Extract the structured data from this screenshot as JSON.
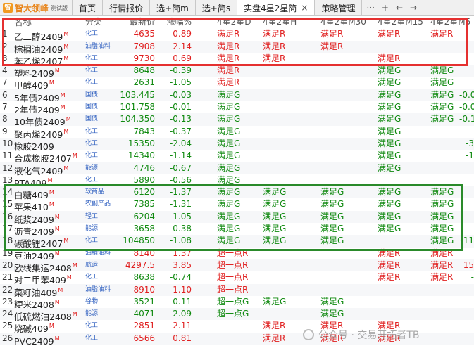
{
  "app": {
    "logo_badge": "智",
    "name": "智大领峰",
    "edition": "测试版"
  },
  "tabs": [
    {
      "label": "首页"
    },
    {
      "label": "行情报价"
    },
    {
      "label": "选+简m"
    },
    {
      "label": "选+简s"
    },
    {
      "label": "实盘4星2星简",
      "active": true
    },
    {
      "label": "策略管理"
    }
  ],
  "tab_close": "×",
  "tools": {
    "more": "···",
    "add": "+",
    "back": "←",
    "forward": "→"
  },
  "columns": [
    "名称",
    "分类",
    "最新价",
    "涨幅%",
    "4星2星D",
    "4星2星H",
    "4星2星M30",
    "4星2星M15",
    "4星2星M5",
    ""
  ],
  "rows": [
    {
      "idx": "1",
      "name": "乙二醇2409",
      "sup": "M",
      "cat": "化工",
      "price": "4635",
      "chg": "0.89",
      "d": [
        "满足R",
        "满足R",
        "满足R",
        "满足R",
        "满足R"
      ],
      "x": ""
    },
    {
      "idx": "2",
      "name": "棕榈油2409",
      "sup": "M",
      "cat": "油脂油料",
      "price": "7908",
      "chg": "2.14",
      "d": [
        "满足R",
        "满足R",
        "满足R",
        "",
        ""
      ],
      "x": ""
    },
    {
      "idx": "3",
      "name": "苯乙烯2407",
      "sup": "M",
      "cat": "化工",
      "price": "9730",
      "chg": "0.69",
      "d": [
        "满足R",
        "满足R",
        "",
        "满足R",
        ""
      ],
      "x": ""
    },
    {
      "idx": "4",
      "name": "塑料2409",
      "sup": "M",
      "cat": "化工",
      "price": "8648",
      "chg": "-0.39",
      "d": [
        "满足R",
        "",
        "",
        "满足G",
        "满足G"
      ],
      "x": ""
    },
    {
      "idx": "7",
      "name": "甲醇409",
      "sup": "M",
      "cat": "化工",
      "price": "2631",
      "chg": "-1.05",
      "d": [
        "满足R",
        "",
        "",
        "满足G",
        "满足G"
      ],
      "x": ""
    },
    {
      "idx": "6",
      "name": "5年债2409",
      "sup": "M",
      "cat": "国债",
      "price": "103.445",
      "chg": "-0.03",
      "d": [
        "满足G",
        "",
        "",
        "满足G",
        "满足G"
      ],
      "x": "-0.0"
    },
    {
      "idx": "7",
      "name": "2年债2409",
      "sup": "M",
      "cat": "国债",
      "price": "101.758",
      "chg": "-0.01",
      "d": [
        "满足G",
        "",
        "",
        "满足G",
        "满足G"
      ],
      "x": "-0.0"
    },
    {
      "idx": "8",
      "name": "10年债2409",
      "sup": "M",
      "cat": "国债",
      "price": "104.350",
      "chg": "-0.13",
      "d": [
        "满足G",
        "",
        "",
        "满足G",
        "满足G"
      ],
      "x": "-0.1"
    },
    {
      "idx": "9",
      "name": "聚丙烯2409",
      "sup": "M",
      "cat": "化工",
      "price": "7843",
      "chg": "-0.37",
      "d": [
        "满足G",
        "",
        "",
        "满足G",
        ""
      ],
      "x": ""
    },
    {
      "idx": "10",
      "name": "橡胶2409",
      "sup": "",
      "cat": "化工",
      "price": "15350",
      "chg": "-2.04",
      "d": [
        "满足G",
        "",
        "",
        "满足G",
        ""
      ],
      "x": "-3"
    },
    {
      "idx": "11",
      "name": "合成橡胶2407",
      "sup": "M",
      "cat": "化工",
      "price": "14340",
      "chg": "-1.14",
      "d": [
        "满足G",
        "",
        "",
        "满足G",
        ""
      ],
      "x": "-1"
    },
    {
      "idx": "12",
      "name": "液化气2409",
      "sup": "M",
      "cat": "能源",
      "price": "4746",
      "chg": "-0.67",
      "d": [
        "满足G",
        "",
        "",
        "满足G",
        ""
      ],
      "x": ""
    },
    {
      "idx": "13",
      "name": "PTA409",
      "sup": "M",
      "cat": "化工",
      "price": "5890",
      "chg": "-0.56",
      "d": [
        "满足G",
        "",
        "",
        "",
        ""
      ],
      "x": ""
    },
    {
      "idx": "14",
      "name": "白糖409",
      "sup": "M",
      "cat": "软商品",
      "price": "6120",
      "chg": "-1.37",
      "d": [
        "满足G",
        "满足G",
        "满足G",
        "满足G",
        "满足G"
      ],
      "x": ""
    },
    {
      "idx": "15",
      "name": "苹果410",
      "sup": "M",
      "cat": "农副产品",
      "price": "7385",
      "chg": "-1.31",
      "d": [
        "满足G",
        "满足G",
        "满足G",
        "满足G",
        "满足G"
      ],
      "x": ""
    },
    {
      "idx": "16",
      "name": "纸浆2409",
      "sup": "M",
      "cat": "轻工",
      "price": "6204",
      "chg": "-1.05",
      "d": [
        "满足G",
        "满足G",
        "满足G",
        "满足G",
        "满足G"
      ],
      "x": ""
    },
    {
      "idx": "17",
      "name": "沥青2409",
      "sup": "M",
      "cat": "能源",
      "price": "3658",
      "chg": "-0.38",
      "d": [
        "满足G",
        "满足G",
        "满足G",
        "满足G",
        "满足G"
      ],
      "x": ""
    },
    {
      "idx": "18",
      "name": "碳酸锂2407",
      "sup": "M",
      "cat": "化工",
      "price": "104850",
      "chg": "-1.08",
      "d": [
        "满足G",
        "满足G",
        "满足G",
        "",
        "满足G"
      ],
      "x": "-11"
    },
    {
      "idx": "19",
      "name": "豆油2409",
      "sup": "M",
      "cat": "油脂油料",
      "price": "8140",
      "chg": "1.37",
      "d": [
        "超一点R",
        "",
        "",
        "满足R",
        "满足R"
      ],
      "x": ""
    },
    {
      "idx": "20",
      "name": "欧线集运2408",
      "sup": "M",
      "cat": "航运",
      "price": "4297.5",
      "chg": "3.85",
      "d": [
        "超一点R",
        "",
        "",
        "满足R",
        "满足R"
      ],
      "x": "15"
    },
    {
      "idx": "21",
      "name": "对二甲苯409",
      "sup": "M",
      "cat": "化工",
      "price": "8638",
      "chg": "-0.74",
      "d": [
        "超一点R",
        "",
        "",
        "满足R",
        "满足R"
      ],
      "x": "-"
    },
    {
      "idx": "22",
      "name": "菜籽油409",
      "sup": "M",
      "cat": "油脂油料",
      "price": "8910",
      "chg": "1.10",
      "d": [
        "超一点R",
        "",
        "",
        "",
        ""
      ],
      "x": ""
    },
    {
      "idx": "23",
      "name": "粳米2408",
      "sup": "M",
      "cat": "谷物",
      "price": "3521",
      "chg": "-0.11",
      "d": [
        "超一点G",
        "满足G",
        "满足G",
        "",
        ""
      ],
      "x": ""
    },
    {
      "idx": "24",
      "name": "低硫燃油2408",
      "sup": "M",
      "cat": "能源",
      "price": "4071",
      "chg": "-2.09",
      "d": [
        "超一点G",
        "",
        "满足G",
        "",
        ""
      ],
      "x": ""
    },
    {
      "idx": "25",
      "name": "烧碱409",
      "sup": "M",
      "cat": "化工",
      "price": "2851",
      "chg": "2.11",
      "d": [
        "",
        "满足R",
        "满足R",
        "满足R",
        ""
      ],
      "x": ""
    },
    {
      "idx": "26",
      "name": "PVC2409",
      "sup": "M",
      "cat": "化工",
      "price": "6566",
      "chg": "0.81",
      "d": [
        "",
        "满足R",
        "满足R",
        "满足R",
        ""
      ],
      "x": ""
    }
  ],
  "watermark": "公众号 · 交易开拓者TB",
  "colors": {
    "up": "#e02020",
    "down": "#118a11",
    "red_box": "#e53030",
    "green_box": "#2a8a2a",
    "logo": "#f29b21"
  }
}
